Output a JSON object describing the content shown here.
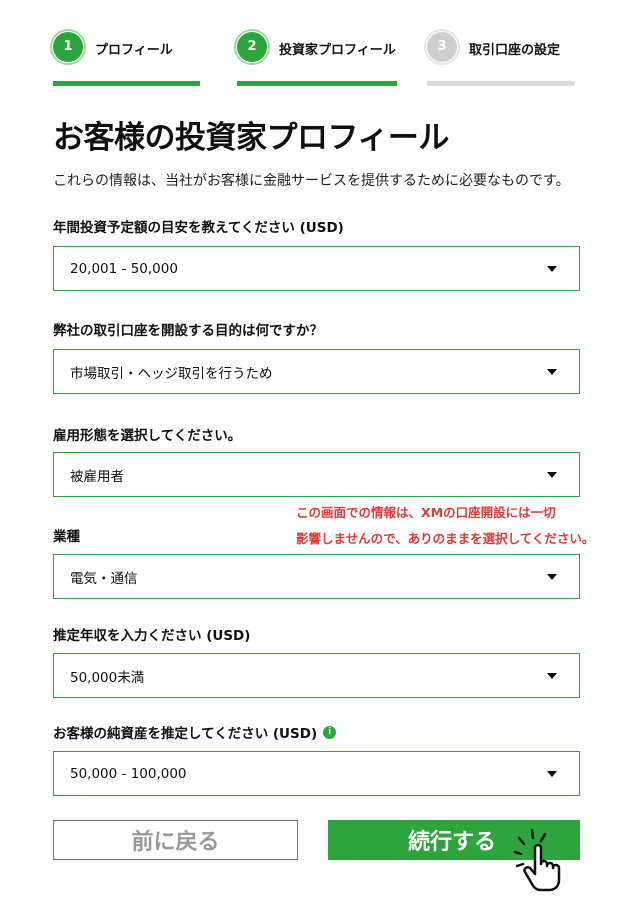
{
  "steps": [
    {
      "number": "1",
      "label": "プロフィール",
      "state": "done"
    },
    {
      "number": "2",
      "label": "投資家プロフィール",
      "state": "done"
    },
    {
      "number": "3",
      "label": "取引口座の設定",
      "state": "todo"
    }
  ],
  "page_title": "お客様の投資家プロフィール",
  "intro": "これらの情報は、当社がお客様に金融サービスを提供するために必要なものです。",
  "fields": {
    "investment_amount": {
      "label": "年間投資予定額の目安を教えてください (USD)",
      "value": "20,001 - 50,000"
    },
    "purpose": {
      "label": "弊社の取引口座を開設する目的は何ですか？",
      "value": "市場取引・ヘッジ取引を行うため"
    },
    "employment": {
      "label": "雇用形態を選択してください。",
      "value": "被雇用者"
    },
    "industry": {
      "label": "業種",
      "value": "電気・通信"
    },
    "income": {
      "label": "推定年収を入力ください (USD)",
      "value": "50,000未満"
    },
    "net_worth": {
      "label": "お客様の純資産を推定してください (USD)",
      "value": "50,000 - 100,000"
    }
  },
  "annotation": {
    "line1": "この画面での情報は、XMの口座開設には一切",
    "line2": "影響しませんので、ありのままを選択してください。"
  },
  "buttons": {
    "back": "前に戻る",
    "next": "続行する"
  },
  "colors": {
    "accent": "#2ea43d",
    "annotation": "#e03a3a"
  },
  "icons": {
    "info": "info-icon",
    "cursor": "hand-pointer-icon",
    "dropdown": "caret-down-icon"
  }
}
